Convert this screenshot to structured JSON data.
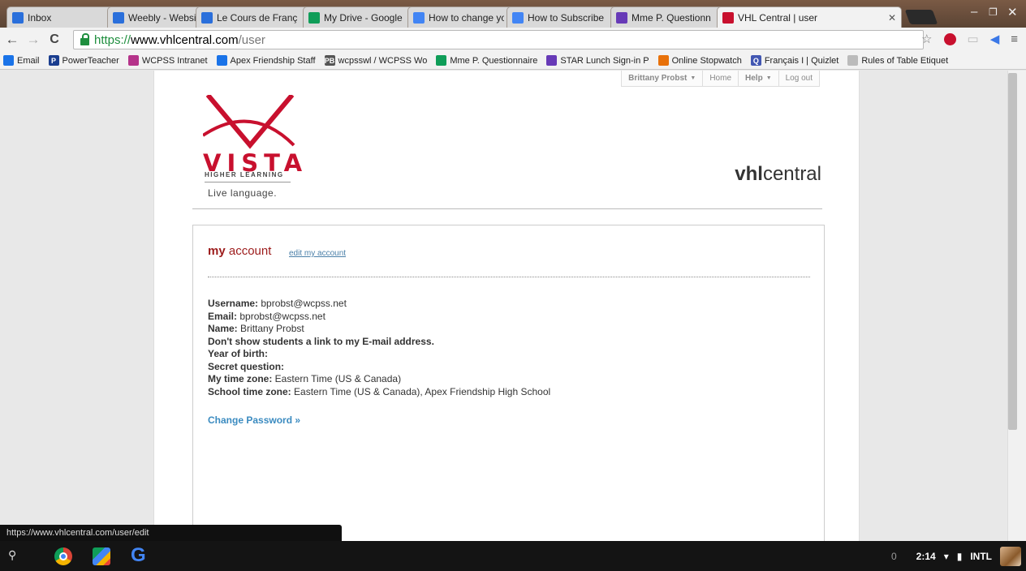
{
  "tabs": [
    {
      "title": "Inbox",
      "icon": "inbox-icon",
      "color": "#2a6fdb"
    },
    {
      "title": "Weebly - Website C",
      "icon": "weebly-icon",
      "color": "#2a6fdb"
    },
    {
      "title": "Le Cours de Franç",
      "icon": "weebly-icon",
      "color": "#2a6fdb"
    },
    {
      "title": "My Drive - Google",
      "icon": "drive-icon",
      "color": "#0f9d58"
    },
    {
      "title": "How to change yo",
      "icon": "docs-icon",
      "color": "#4285f4"
    },
    {
      "title": "How to Subscribe",
      "icon": "docs-icon",
      "color": "#4285f4"
    },
    {
      "title": "Mme P. Questionn",
      "icon": "forms-icon",
      "color": "#673ab7"
    },
    {
      "title": "VHL Central | user",
      "icon": "vhl-icon",
      "color": "#c8102e",
      "active": true
    }
  ],
  "url": {
    "scheme": "https://",
    "host": "www.vhlcentral.com",
    "path": "/user"
  },
  "bookmarks": [
    {
      "label": "Email",
      "icon": "globe-icon",
      "color": "#1a73e8"
    },
    {
      "label": "PowerTeacher",
      "icon": "powerteacher-icon",
      "color": "#1a3d8f",
      "glyph": "P"
    },
    {
      "label": "WCPSS Intranet",
      "icon": "wcpss-icon",
      "color": "#b5338a"
    },
    {
      "label": "Apex Friendship Staff",
      "icon": "sites-icon",
      "color": "#1a73e8"
    },
    {
      "label": "wcpsswl / WCPSS Wo",
      "icon": "pbworks-icon",
      "color": "#555",
      "glyph": "PB"
    },
    {
      "label": "Mme P. Questionnaire",
      "icon": "sheets-icon",
      "color": "#0f9d58"
    },
    {
      "label": "STAR Lunch Sign-in P",
      "icon": "forms-icon",
      "color": "#673ab7"
    },
    {
      "label": "Online Stopwatch",
      "icon": "stopwatch-icon",
      "color": "#e8710a"
    },
    {
      "label": "Français I | Quizlet",
      "icon": "quizlet-icon",
      "color": "#4257b2",
      "glyph": "Q"
    },
    {
      "label": "Rules of Table Etiquet",
      "icon": "page-icon",
      "color": "#bbb"
    }
  ],
  "userbar": {
    "user": "Brittany Probst",
    "home": "Home",
    "help": "Help",
    "logout": "Log out"
  },
  "brand": {
    "vista": "VISTA",
    "higher_learning": "HIGHER LEARNING",
    "tagline": "Live language.",
    "vhl_bold": "vhl",
    "vhl_rest": "central",
    "accent": "#c8102e"
  },
  "account": {
    "title_bold": "my",
    "title_rest": " account",
    "edit_link": "edit my account",
    "username_label": "Username:",
    "username": " bprobst@wcpss.net",
    "email_label": "Email:",
    "email": " bprobst@wcpss.net",
    "name_label": "Name:",
    "name": " Brittany Probst",
    "no_link": "Don't show students a link to my E-mail address.",
    "yob_label": "Year of birth:",
    "secret_label": "Secret question:",
    "tz_label": "My time zone:",
    "tz": " Eastern Time (US & Canada)",
    "school_tz_label": "School time zone:",
    "school_tz": " Eastern Time (US & Canada), Apex Friendship High School",
    "change_password": "Change Password »"
  },
  "status_url": "https://www.vhlcentral.com/user/edit",
  "tray": {
    "notifications": "0",
    "time": "2:14",
    "ime": "INTL"
  }
}
